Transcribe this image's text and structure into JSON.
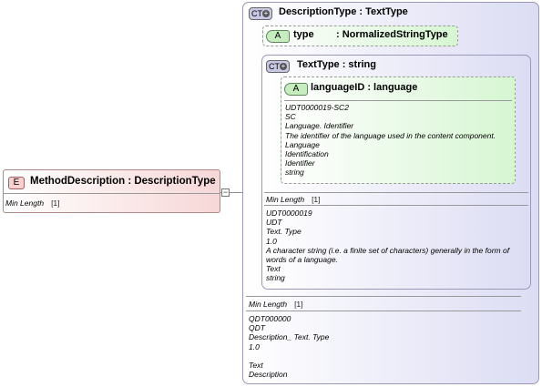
{
  "element": {
    "badge": "E",
    "title": "MethodDescription : DescriptionType",
    "facet_label": "Min Length",
    "facet_value": "[1]"
  },
  "description_type": {
    "badge": "CT",
    "title": "DescriptionType : TextType",
    "type_attr": {
      "badge": "A",
      "name": "type",
      "type": ": NormalizedStringType"
    },
    "facet_label": "Min Length",
    "facet_value": "[1]",
    "doc": [
      "QDT000000",
      "QDT",
      "Description_ Text. Type",
      "1.0",
      "",
      "Text",
      "Description"
    ]
  },
  "text_type": {
    "badge": "CT",
    "title": "TextType : string",
    "language_attr": {
      "badge": "A",
      "title": "languageID : language",
      "doc": [
        "UDT0000019-SC2",
        "SC",
        "Language. Identifier",
        "The identifier of the language used in the content component.",
        "Language",
        "Identification",
        "Identifier",
        "string"
      ]
    },
    "facet_label": "Min Length",
    "facet_value": "[1]",
    "doc": [
      "UDT0000019",
      "UDT",
      "Text. Type",
      "1.0",
      "A character string (i.e. a finite set of characters) generally in the form of",
      "words of a language.",
      "Text",
      "string"
    ]
  }
}
